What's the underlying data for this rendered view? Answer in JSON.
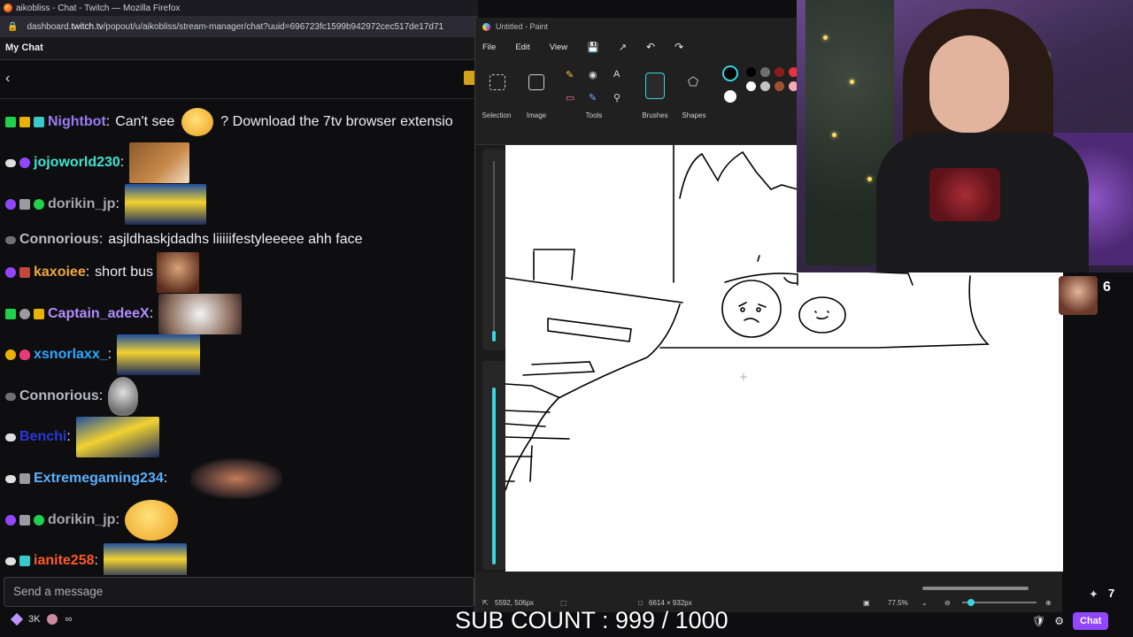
{
  "browser": {
    "title": "aikobliss - Chat - Twitch — Mozilla Firefox",
    "url_prefix": "dashboard.",
    "url_domain": "twitch.tv",
    "url_rest": "/popout/u/aikobliss/stream-manager/chat?uuid=696723fc1599b942972cec517de17d71"
  },
  "chat": {
    "header": "My Chat",
    "messages": [
      {
        "user": "Nightbot",
        "color": "#9b7bf0",
        "text": "? Download the 7tv browser extensio",
        "prefix": "Can't see"
      },
      {
        "user": "jojoworld230",
        "color": "#3fe3d0"
      },
      {
        "user": "dorikin_jp",
        "color": "#a7a7ad"
      },
      {
        "user": "Connorious",
        "color": "#b9b9c2",
        "text": "asjldhaskjdadhs liiiiifestyleeeee ahh face"
      },
      {
        "user": "kaxoiee",
        "color": "#f0a640",
        "text": "short bus"
      },
      {
        "user": "Captain_adeeX",
        "color": "#b18cff"
      },
      {
        "user": "xsnorlaxx_",
        "color": "#2fa7ff"
      },
      {
        "user": "Connorious",
        "color": "#b9b9c2"
      },
      {
        "user": "Benchi",
        "color": "#2a37d6"
      },
      {
        "user": "Extremegaming234",
        "color": "#5ab0ff"
      },
      {
        "user": "dorikin_jp",
        "color": "#a7a7ad"
      },
      {
        "user": "ianite258",
        "color": "#ff5a2a"
      }
    ],
    "input_placeholder": "Send a message",
    "points": "3K",
    "infinity": "∞",
    "chat_button": "Chat"
  },
  "paint": {
    "title": "Untitled - Paint",
    "menu": [
      "File",
      "Edit",
      "View"
    ],
    "ribbon": {
      "selection": "Selection",
      "image": "Image",
      "tools": "Tools",
      "brushes": "Brushes",
      "shapes": "Shapes"
    },
    "status": {
      "cursor": "5592, 506px",
      "size": "6614 × 932px",
      "zoom": "77.5%"
    },
    "palette": [
      "#000000",
      "#6e6e6e",
      "#8a1c1c",
      "#e8323c",
      "#ffffff",
      "#c4c4c4",
      "#a0522d",
      "#f7a8b8"
    ]
  },
  "stream": {
    "viewer_count": "6",
    "sub_count": "SUB COUNT : 999 / 1000"
  }
}
